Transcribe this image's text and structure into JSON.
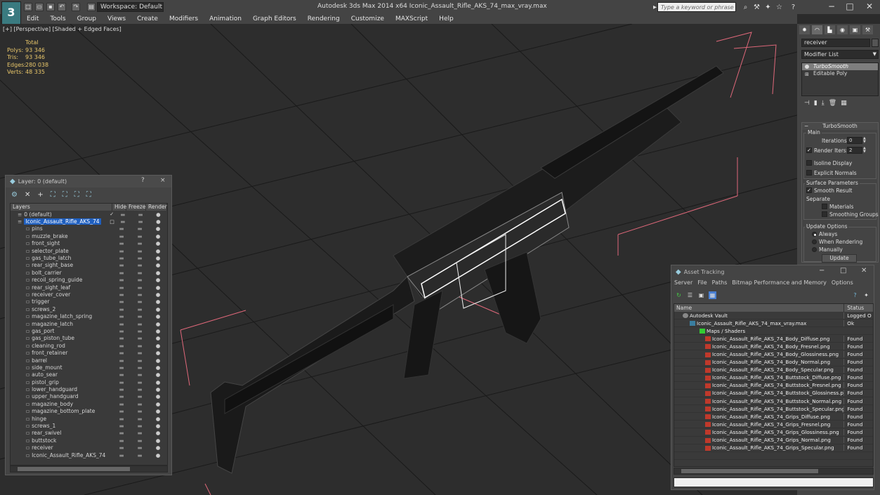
{
  "app": {
    "icon_label": "3",
    "workspace": "Workspace: Default",
    "title": "Autodesk 3ds Max 2014 x64      Iconic_Assault_Rifle_AKS_74_max_vray.max",
    "search_placeholder": "Type a keyword or phrase"
  },
  "menu": [
    "Edit",
    "Tools",
    "Group",
    "Views",
    "Create",
    "Modifiers",
    "Animation",
    "Graph Editors",
    "Rendering",
    "Customize",
    "MAXScript",
    "Help"
  ],
  "viewport": {
    "label": "[+] [Perspective] [Shaded + Edged Faces]",
    "stats": {
      "header": "Total",
      "rows": [
        {
          "label": "Polys:",
          "value": "93 346"
        },
        {
          "label": "Tris:",
          "value": "93 346"
        },
        {
          "label": "Edges:",
          "value": "280 038"
        },
        {
          "label": "Verts:",
          "value": "48 335"
        }
      ]
    }
  },
  "layer_window": {
    "title": "Layer: 0 (default)",
    "help": "?",
    "close": "×",
    "columns": [
      "Layers",
      "Hide",
      "Freeze",
      "Render"
    ],
    "top_layers": [
      {
        "name": "0 (default)",
        "check": "✓"
      },
      {
        "name": "Iconic_Assault_Rifle_AKS_74",
        "check": "□"
      }
    ],
    "objects": [
      "pins",
      "muzzle_brake",
      "front_sight",
      "selector_plate",
      "gas_tube_latch",
      "rear_sight_base",
      "bolt_carrier",
      "recoil_spring_guide",
      "rear_sight_leaf",
      "receiver_cover",
      "trigger",
      "screws_2",
      "magazine_latch_spring",
      "magazine_latch",
      "gas_port",
      "gas_piston_tube",
      "cleaning_rod",
      "front_retainer",
      "barrel",
      "side_mount",
      "auto_sear",
      "pistol_grip",
      "lower_handguard",
      "upper_handguard",
      "magazine_body",
      "magazine_bottom_plate",
      "hinge",
      "screws_1",
      "rear_swivel",
      "buttstock",
      "receiver",
      "Iconic_Assault_Rifle_AKS_74"
    ]
  },
  "command_panel": {
    "object_name": "receiver",
    "modifier_list": "Modifier List",
    "stack": [
      {
        "name": "TurboSmooth",
        "type": "modifier"
      },
      {
        "name": "Editable Poly",
        "type": "base"
      }
    ],
    "turbosmooth": {
      "title": "TurboSmooth",
      "main_group": "Main",
      "iterations_label": "Iterations:",
      "iterations_value": "0",
      "render_iters_label": "Render Iters:",
      "render_iters_value": "2",
      "isoline_label": "Isoline Display",
      "explicit_label": "Explicit Normals",
      "surface_group": "Surface Parameters",
      "smooth_result_label": "Smooth Result",
      "separate_label": "Separate",
      "materials_label": "Materials",
      "smoothing_groups_label": "Smoothing Groups",
      "update_group": "Update Options",
      "always_label": "Always",
      "when_rendering_label": "When Rendering",
      "manually_label": "Manually",
      "update_button": "Update"
    }
  },
  "asset_tracking": {
    "title": "Asset Tracking",
    "menu": [
      "Server",
      "File",
      "Paths",
      "Bitmap Performance and Memory",
      "Options"
    ],
    "columns": [
      "Name",
      "Status"
    ],
    "rows": [
      {
        "name": "Autodesk Vault",
        "status": "Logged O",
        "level": 0,
        "kind": "vault"
      },
      {
        "name": "Iconic_Assault_Rifle_AKS_74_max_vray.max",
        "status": "Ok",
        "level": 1,
        "kind": "max"
      },
      {
        "name": "Maps / Shaders",
        "status": "",
        "level": 2,
        "kind": "folder"
      },
      {
        "name": "Iconic_Assault_Rifle_AKS_74_Body_Diffuse.png",
        "status": "Found",
        "level": 3,
        "kind": "png"
      },
      {
        "name": "Iconic_Assault_Rifle_AKS_74_Body_Fresnel.png",
        "status": "Found",
        "level": 3,
        "kind": "png"
      },
      {
        "name": "Iconic_Assault_Rifle_AKS_74_Body_Glossiness.png",
        "status": "Found",
        "level": 3,
        "kind": "png"
      },
      {
        "name": "Iconic_Assault_Rifle_AKS_74_Body_Normal.png",
        "status": "Found",
        "level": 3,
        "kind": "png"
      },
      {
        "name": "Iconic_Assault_Rifle_AKS_74_Body_Specular.png",
        "status": "Found",
        "level": 3,
        "kind": "png"
      },
      {
        "name": "Iconic_Assault_Rifle_AKS_74_Buttstock_Diffuse.png",
        "status": "Found",
        "level": 3,
        "kind": "png"
      },
      {
        "name": "Iconic_Assault_Rifle_AKS_74_Buttstock_Fresnel.png",
        "status": "Found",
        "level": 3,
        "kind": "png"
      },
      {
        "name": "Iconic_Assault_Rifle_AKS_74_Buttstock_Glossiness.png",
        "status": "Found",
        "level": 3,
        "kind": "png"
      },
      {
        "name": "Iconic_Assault_Rifle_AKS_74_Buttstock_Normal.png",
        "status": "Found",
        "level": 3,
        "kind": "png"
      },
      {
        "name": "Iconic_Assault_Rifle_AKS_74_Buttstock_Specular.png",
        "status": "Found",
        "level": 3,
        "kind": "png"
      },
      {
        "name": "Iconic_Assault_Rifle_AKS_74_Grips_Diffuse.png",
        "status": "Found",
        "level": 3,
        "kind": "png"
      },
      {
        "name": "Iconic_Assault_Rifle_AKS_74_Grips_Fresnel.png",
        "status": "Found",
        "level": 3,
        "kind": "png"
      },
      {
        "name": "Iconic_Assault_Rifle_AKS_74_Grips_Glossiness.png",
        "status": "Found",
        "level": 3,
        "kind": "png"
      },
      {
        "name": "Iconic_Assault_Rifle_AKS_74_Grips_Normal.png",
        "status": "Found",
        "level": 3,
        "kind": "png"
      },
      {
        "name": "Iconic_Assault_Rifle_AKS_74_Grips_Specular.png",
        "status": "Found",
        "level": 3,
        "kind": "png"
      }
    ]
  },
  "colors": {
    "selection": "#1f5fbf",
    "stats_text": "#e8c66a",
    "bbox_lines": "#e0687a",
    "png_icon": "#c0392b"
  }
}
